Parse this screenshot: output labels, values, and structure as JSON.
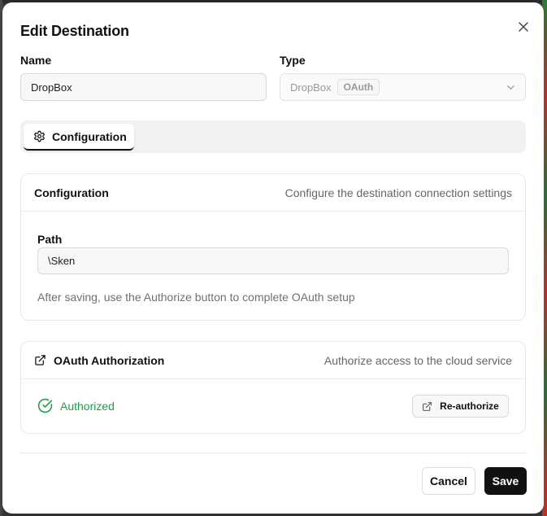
{
  "dialog": {
    "title": "Edit Destination",
    "close_icon": "close-icon"
  },
  "name_field": {
    "label": "Name",
    "value": "DropBox"
  },
  "type_field": {
    "label": "Type",
    "value": "DropBox",
    "badge": "OAuth",
    "icon": "chevron-down-icon"
  },
  "tabs": [
    {
      "label": "Configuration",
      "icon": "gear-icon",
      "active": true
    }
  ],
  "configuration_card": {
    "title": "Configuration",
    "description": "Configure the destination connection settings",
    "path_label": "Path",
    "path_value": "\\Sken",
    "help_text": "After saving, use the Authorize button to complete OAuth setup"
  },
  "oauth_card": {
    "title": "OAuth Authorization",
    "title_icon": "external-link-icon",
    "description": "Authorize access to the cloud service",
    "status": "Authorized",
    "status_icon": "check-circle-icon",
    "status_color": "#1f9d4a",
    "reauthorize_label": "Re-authorize",
    "reauthorize_icon": "external-link-icon"
  },
  "footer": {
    "cancel_label": "Cancel",
    "save_label": "Save"
  }
}
